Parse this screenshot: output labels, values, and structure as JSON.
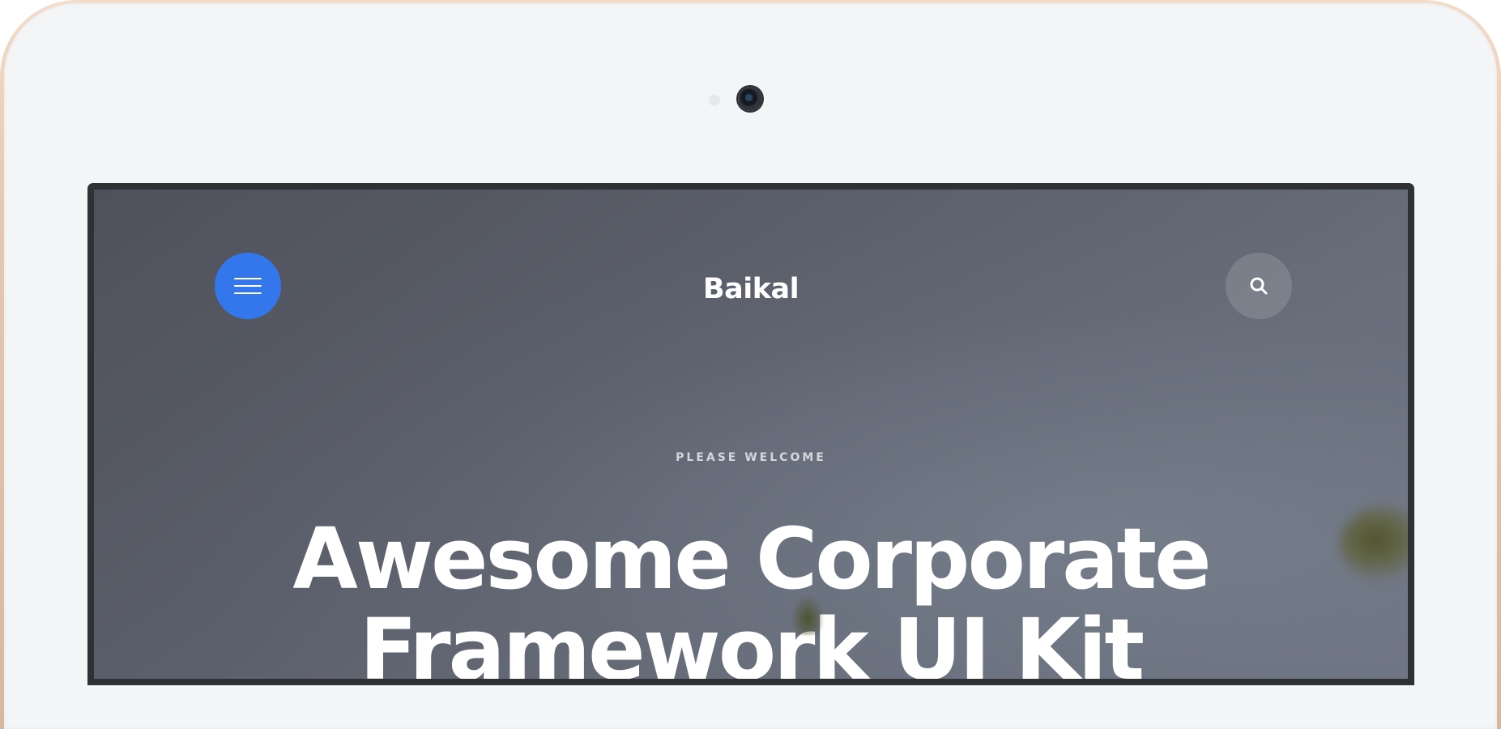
{
  "header": {
    "brand": "Baikal",
    "menu_icon": "hamburger-menu-icon",
    "search_icon": "search-icon"
  },
  "hero": {
    "eyebrow": "PLEASE WELCOME",
    "headline_line1": "Awesome Corporate",
    "headline_line2": "Framework UI Kit"
  },
  "colors": {
    "menu_button": "#3477ec",
    "text": "#ffffff"
  }
}
